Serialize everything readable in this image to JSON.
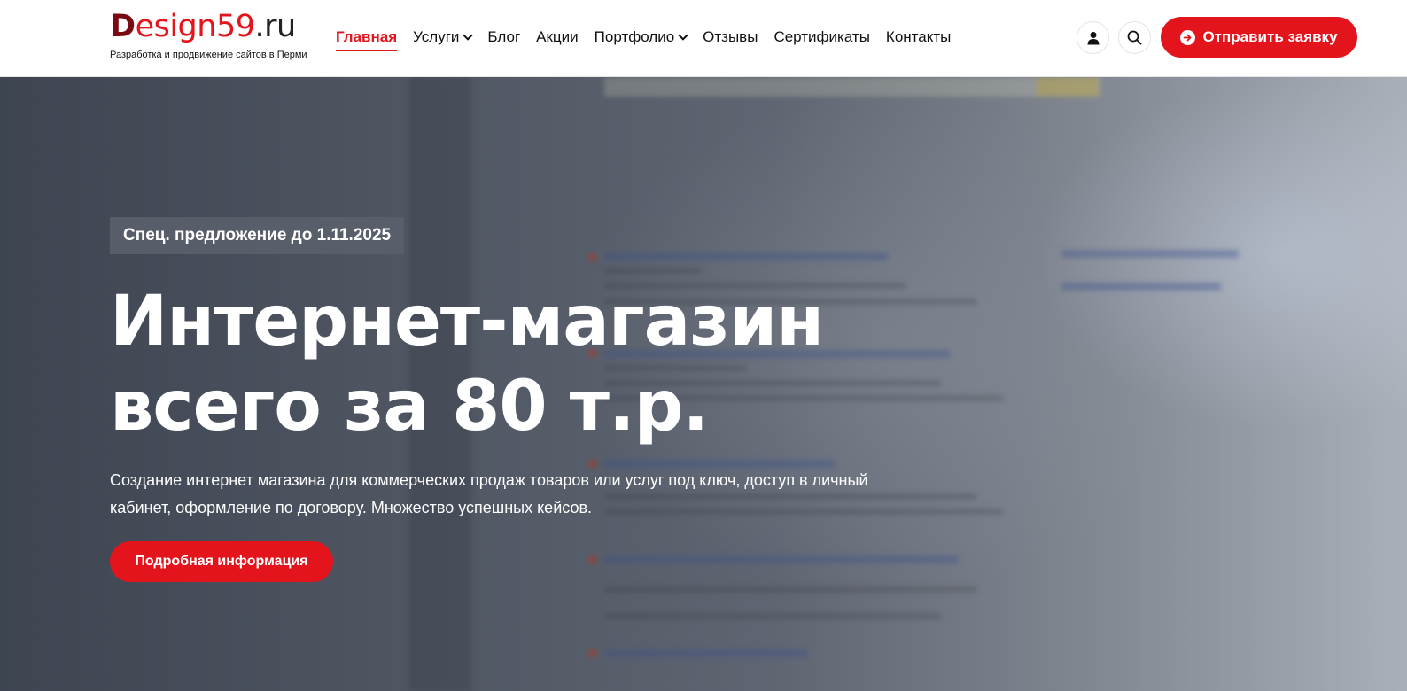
{
  "header": {
    "logo": {
      "part1": "D",
      "part2": "esign59",
      "part3": ".ru",
      "tagline": "Разработка и продвижение сайтов в Перми"
    },
    "nav": [
      {
        "label": "Главная",
        "active": true,
        "dropdown": false
      },
      {
        "label": "Услуги",
        "active": false,
        "dropdown": true
      },
      {
        "label": "Блог",
        "active": false,
        "dropdown": false
      },
      {
        "label": "Акции",
        "active": false,
        "dropdown": false
      },
      {
        "label": "Портфолио",
        "active": false,
        "dropdown": true
      },
      {
        "label": "Отзывы",
        "active": false,
        "dropdown": false
      },
      {
        "label": "Сертификаты",
        "active": false,
        "dropdown": false
      },
      {
        "label": "Контакты",
        "active": false,
        "dropdown": false
      }
    ],
    "icons": {
      "user": "user-icon",
      "search": "search-icon",
      "cta": "arrow-right-circle-icon"
    },
    "cta_label": "Отправить заявку"
  },
  "hero": {
    "badge": "Спец. предложение до 1.11.2025",
    "title_line1": "Интернет-магазин",
    "title_line2": "всего за 80 т.р.",
    "text": "Создание интернет магазина для коммерческих продаж товаров или услуг под ключ, доступ в личный кабинет, оформление по договору. Множество успешных кейсов.",
    "button_label": "Подробная информация"
  },
  "colors": {
    "accent": "#e3141c",
    "logo_dark": "#7a0a12",
    "text": "#111111",
    "white": "#ffffff"
  }
}
